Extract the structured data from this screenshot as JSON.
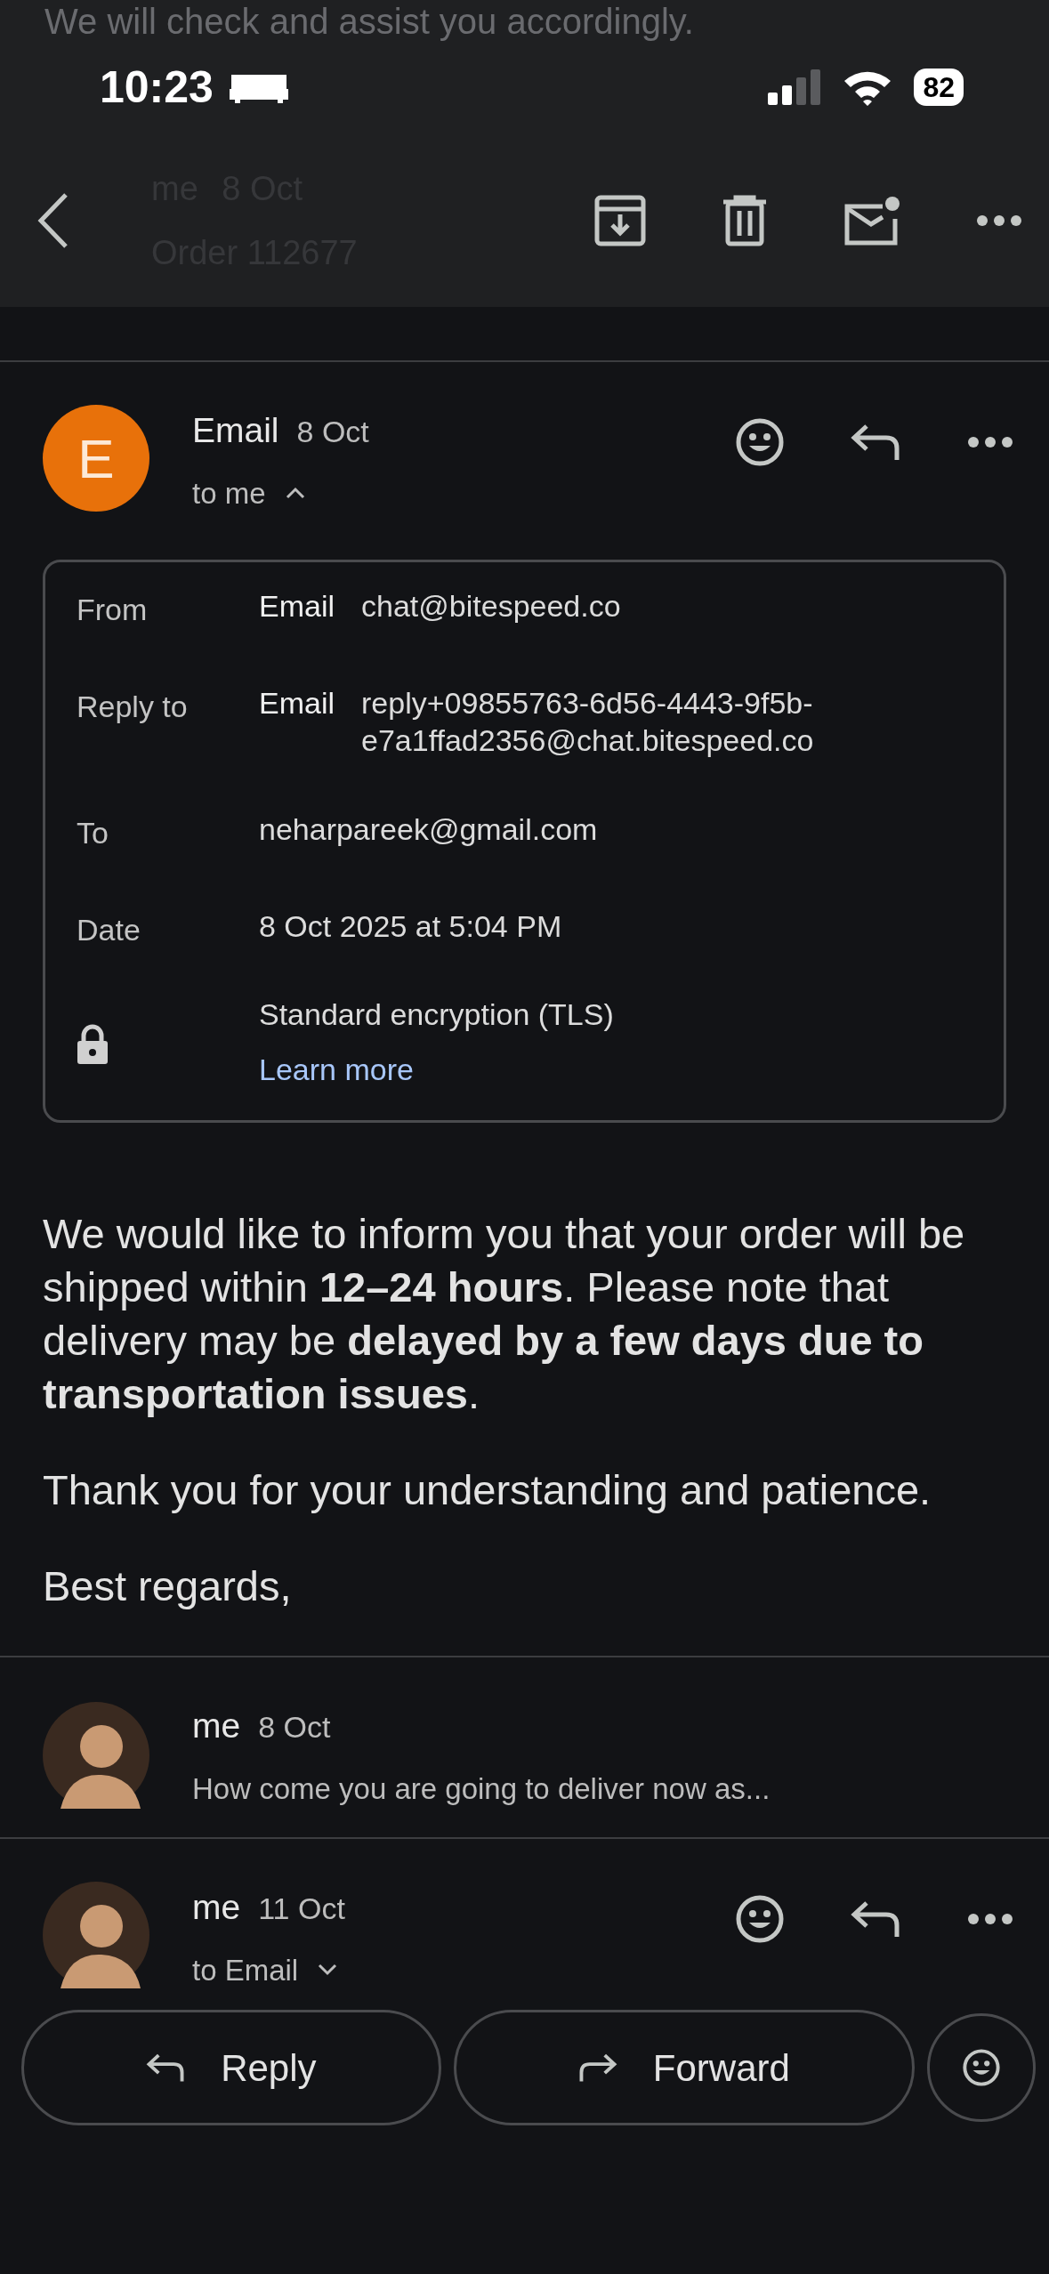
{
  "background_text": "We will check and assist you accordingly.",
  "status_bar": {
    "time": "10:23",
    "battery": "82"
  },
  "toolbar": {
    "behind_message": {
      "sender": "me",
      "date": "8 Oct",
      "subject": "Order 112677"
    }
  },
  "message": {
    "sender": "Email",
    "avatar_letter": "E",
    "date": "8 Oct",
    "recipients": "to me",
    "expanded": true,
    "details": [
      {
        "kind": "field",
        "label": "From",
        "name": "Email",
        "value": "chat@bitespeed.co"
      },
      {
        "kind": "field",
        "label": "Reply to",
        "name": "Email",
        "value": "reply+09855763-6d56-4443-9f5b-e7a1ffad2356@chat.bitespeed.co"
      },
      {
        "kind": "field",
        "label": "To",
        "value": "neharpareek@gmail.com"
      },
      {
        "kind": "field",
        "label": "Date",
        "value": "8 Oct 2025 at 5:04 PM"
      },
      {
        "kind": "security",
        "text": "Standard encryption (TLS)",
        "link": "Learn more"
      }
    ],
    "body": [
      "We would like to inform you that your order will be shipped within **12–24 hours**. Please note that delivery may be **delayed by a few days due to transportation issues**.",
      "Thank you for your understanding and patience.",
      "Best regards,"
    ]
  },
  "thread": [
    {
      "kind": "collapsed",
      "sender": "me",
      "date": "8 Oct",
      "snippet": "How come you are going to deliver now as..."
    },
    {
      "kind": "open",
      "sender": "me",
      "date": "11 Oct",
      "recipients": "to Email",
      "expanded": false
    }
  ],
  "actions": [
    "Reply",
    "Forward"
  ]
}
